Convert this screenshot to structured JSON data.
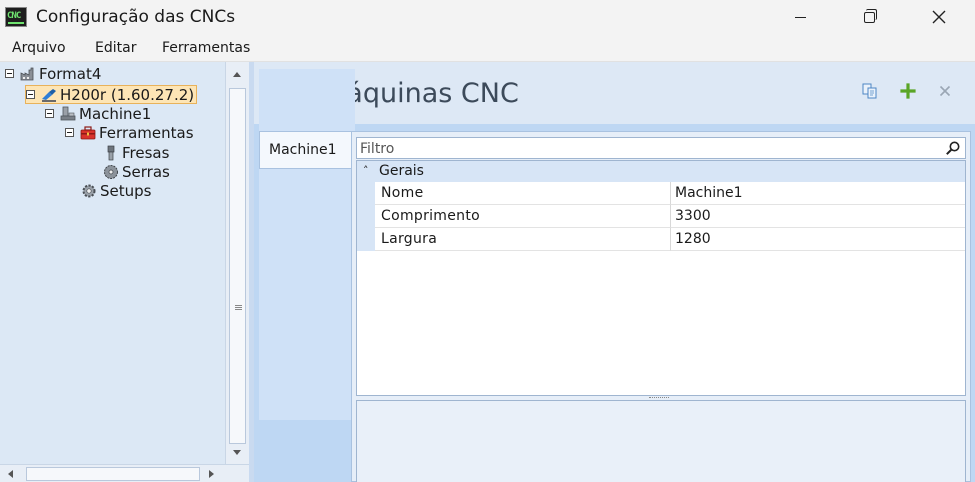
{
  "window": {
    "title": "Configuração das CNCs",
    "app_icon_text": "CNC"
  },
  "menu": {
    "items": [
      "Arquivo",
      "Editar",
      "Ferramentas"
    ]
  },
  "tree": {
    "nodes": [
      {
        "label": "Format4",
        "icon": "factory-icon",
        "expanded": true
      },
      {
        "label": "H200r (1.60.27.2)",
        "icon": "h200-icon",
        "expanded": true,
        "selected": true
      },
      {
        "label": "Machine1",
        "icon": "machine-icon",
        "expanded": true
      },
      {
        "label": "Ferramentas",
        "icon": "toolbox-icon",
        "expanded": true
      },
      {
        "label": "Fresas",
        "icon": "mill-tool-icon"
      },
      {
        "label": "Serras",
        "icon": "saw-blade-icon"
      },
      {
        "label": "Setups",
        "icon": "gear-icon"
      }
    ]
  },
  "content": {
    "title": "Máquinas CNC",
    "toolbar": {
      "copy": "copy-icon",
      "add": "plus-icon",
      "delete": "close-icon"
    },
    "tabs": [
      {
        "label": "Machine1",
        "active": true
      }
    ],
    "filter_placeholder": "Filtro",
    "group": "Gerais",
    "properties": [
      {
        "name": "Nome",
        "value": "Machine1"
      },
      {
        "name": "Comprimento",
        "value": "3300"
      },
      {
        "name": "Largura",
        "value": "1280"
      }
    ]
  },
  "colors": {
    "selection_bg": "#fde5b5",
    "selection_border": "#e8b25b",
    "panel_bg": "#dce8f5",
    "header_text": "#3c4a5a",
    "add_green": "#5aa526"
  }
}
